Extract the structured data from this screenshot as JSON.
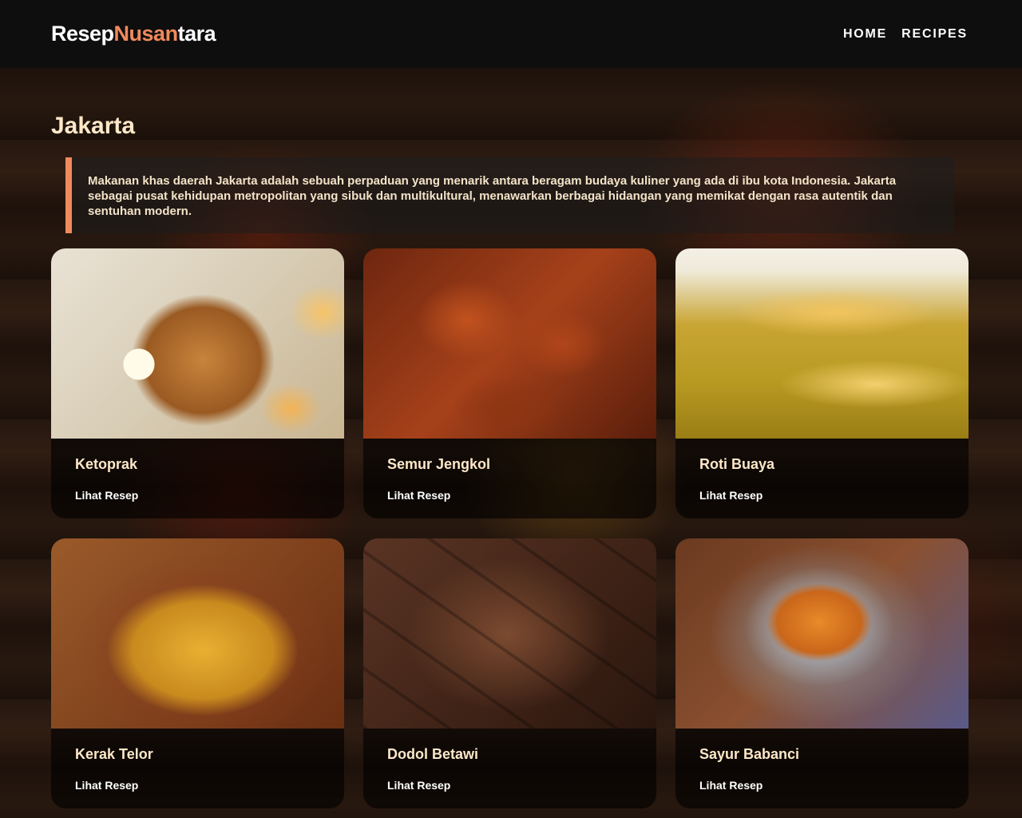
{
  "header": {
    "brand_part1": "Resep",
    "brand_part2": "Nusan",
    "brand_part3": "tara",
    "brand_accent_color": "#f08a5d",
    "nav": [
      {
        "label": "HOME"
      },
      {
        "label": "RECIPES"
      }
    ]
  },
  "page": {
    "title": "Jakarta",
    "description": "Makanan khas daerah Jakarta adalah sebuah perpaduan yang menarik antara beragam budaya kuliner yang ada di ibu kota Indonesia. Jakarta sebagai pusat kehidupan metropolitan yang sibuk dan multikultural, menawarkan berbagai hidangan yang memikat dengan rasa autentik dan sentuhan modern."
  },
  "recipes": [
    {
      "title": "Ketoprak",
      "link": "Lihat Resep"
    },
    {
      "title": "Semur Jengkol",
      "link": "Lihat Resep"
    },
    {
      "title": "Roti Buaya",
      "link": "Lihat Resep"
    },
    {
      "title": "Kerak Telor",
      "link": "Lihat Resep"
    },
    {
      "title": "Dodol Betawi",
      "link": "Lihat Resep"
    },
    {
      "title": "Sayur Babanci",
      "link": "Lihat Resep"
    }
  ]
}
